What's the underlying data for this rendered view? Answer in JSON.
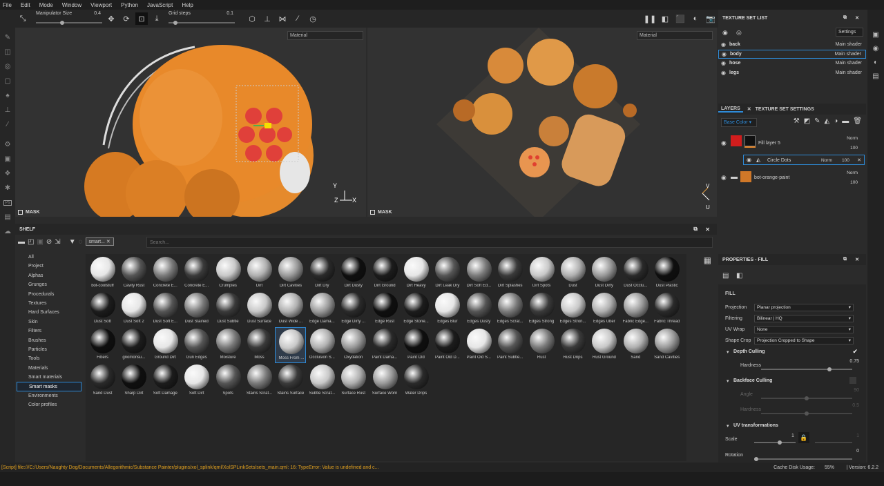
{
  "menu": [
    "File",
    "Edit",
    "Mode",
    "Window",
    "Viewport",
    "Python",
    "JavaScript",
    "Help"
  ],
  "toolbar": {
    "manipulator_label": "Manipulator Size",
    "manipulator_value": "0.4",
    "manipulator_level": 0.4,
    "grid_label": "Grid steps",
    "grid_value": "0.1",
    "grid_level": 0.1
  },
  "viewport": {
    "left_mode": "Material",
    "right_mode": "Material",
    "mask_label": "MASK"
  },
  "texture_set_list": {
    "title": "TEXTURE SET LIST",
    "settings_label": "Settings",
    "items": [
      {
        "name": "back",
        "shader": "Main shader",
        "selected": false
      },
      {
        "name": "body",
        "shader": "Main shader",
        "selected": true
      },
      {
        "name": "hose",
        "shader": "Main shader",
        "selected": false
      },
      {
        "name": "legs",
        "shader": "Main shader",
        "selected": false
      }
    ]
  },
  "layers": {
    "tab_layers": "LAYERS",
    "tab_settings": "TEXTURE SET SETTINGS",
    "channel": "Base Color",
    "items": [
      {
        "name": "Fill layer 5",
        "blend": "Norm",
        "opacity": "100"
      },
      {
        "name": "Circle Dots",
        "blend": "Norm",
        "opacity": "100"
      },
      {
        "name": "bot-orange-paint",
        "blend": "Norm",
        "opacity": "100"
      }
    ]
  },
  "shelf": {
    "title": "SHELF",
    "filter_tag": "smart...",
    "search_placeholder": "Search...",
    "categories": [
      "All",
      "Project",
      "Alphas",
      "Grunges",
      "Procedurals",
      "Textures",
      "Hard Surfaces",
      "Skin",
      "Filters",
      "Brushes",
      "Particles",
      "Tools",
      "Materials",
      "Smart materials",
      "Smart masks",
      "Environments",
      "Color profiles"
    ],
    "selected_category": "Smart masks",
    "items": [
      "bot-coolstuff",
      "Cavity Rust",
      "Concrete E...",
      "Concrete E...",
      "Crumples",
      "Dirt",
      "Dirt Cavities",
      "Dirt Dry",
      "Dirt Dusty",
      "Dirt Ground",
      "Dirt Heavy",
      "Dirt Leak Dry",
      "Dirt Soft Ed...",
      "Dirt Splashes",
      "Dirt Spots",
      "Dust",
      "Dust Dirty",
      "Dust Occlu...",
      "Dust Plastic",
      "Dust Soft",
      "Dust Soft 2",
      "Dust Soft E...",
      "Dust Stained",
      "Dust Subtle",
      "Dust Surface",
      "Dust Wide ...",
      "Edge Dama...",
      "Edge Dirty ...",
      "Edge Rust",
      "Edge Stone...",
      "Edges Blur",
      "Edges Dusty",
      "Edges Scrat...",
      "Edges Strong",
      "Edges Stron...",
      "Edges Uber",
      "Fabric Edge...",
      "Fabric Thread",
      "Fibers",
      "gnomonsu...",
      "Ground Dirt",
      "Gun Edges",
      "Moisture",
      "Moss",
      "Moss From ...",
      "Occlusion S...",
      "Oxydation",
      "Paint Dama...",
      "Paint Old",
      "Paint Old D...",
      "Paint Old S...",
      "Paint Subtle...",
      "Rust",
      "Rust Drips",
      "Rust Ground",
      "Sand",
      "Sand Cavities",
      "Sand Dust",
      "Sharp Dirt",
      "Soft Damage",
      "Soft Dirt",
      "Spots",
      "Stains Scrat...",
      "Stains Surface",
      "Subtle Scrat...",
      "Surface Rust",
      "Surface Worn",
      "Water Drips"
    ],
    "selected_item": "Moss From ..."
  },
  "properties": {
    "title": "PROPERTIES - FILL",
    "fill_label": "FILL",
    "projection_label": "Projection",
    "projection_value": "Planar projection",
    "filtering_label": "Filtering",
    "filtering_value": "Bilinear | HQ",
    "uvwrap_label": "UV Wrap",
    "uvwrap_value": "None",
    "shapecrop_label": "Shape Crop",
    "shapecrop_value": "Projection Cropped to Shape",
    "depth_culling": "Depth Culling",
    "hardness_label": "Hardness",
    "hardness_value": "0.75",
    "backface_culling": "Backface Culling",
    "angle_label": "Angle",
    "angle_value": "90",
    "hardness2_label": "Hardness",
    "hardness2_value": "0.5",
    "uv_transformations": "UV transformations",
    "scale_label": "Scale",
    "scale_value": "1",
    "scale_value2": "1",
    "rotation_label": "Rotation",
    "rotation_value": "0"
  },
  "status": {
    "message": "[Script] file:///C:/Users/Naughty Dog/Documents/Allegorithmic/Substance Painter/plugins/xol_splink/qml/XolSPLinkSets/sets_main.qml: 16: TypeError: Value is undefined and c...",
    "cache_label": "Cache Disk Usage:",
    "cache_value": "55%",
    "version": "| Version: 6.2.2"
  },
  "colors": {
    "accent": "#2e8bd8",
    "orange": "#e8882a",
    "status_text": "#e0a020"
  }
}
